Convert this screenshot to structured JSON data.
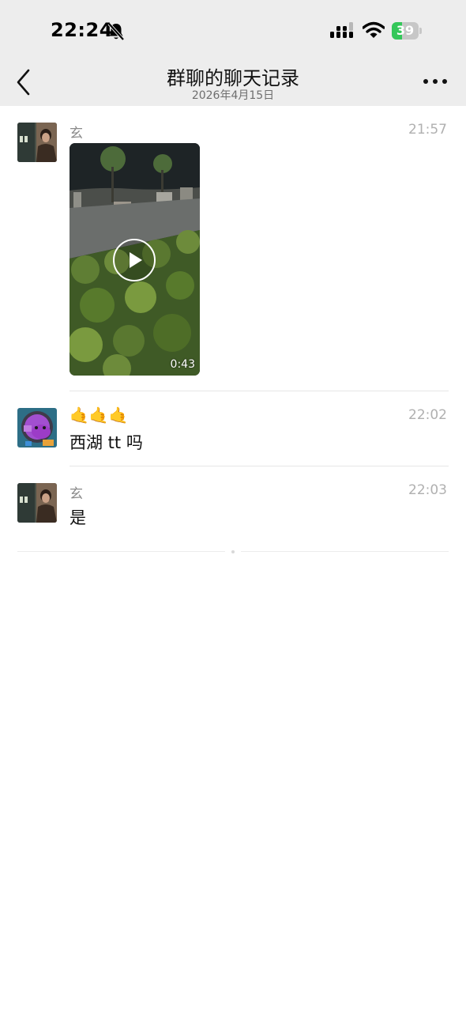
{
  "status_bar": {
    "time": "22:24",
    "silent_icon": "bell-slash-icon",
    "battery": "39",
    "battery_fraction": 0.39,
    "battery_color": "#34c759"
  },
  "header": {
    "title": "群聊的聊天记录",
    "date": "2026年4月15日",
    "back_icon": "chevron-left-icon",
    "more_icon": "ellipsis-icon"
  },
  "messages": [
    {
      "sender": "玄",
      "time": "21:57",
      "type": "video",
      "duration": "0:43",
      "avatar": "person-photo-avatar"
    },
    {
      "sender": "🤙🤙🤙",
      "time": "22:02",
      "type": "text",
      "text": "西湖 tt 吗",
      "avatar": "purple-cartoon-avatar"
    },
    {
      "sender": "玄",
      "time": "22:03",
      "type": "text",
      "text": "是",
      "avatar": "person-photo-avatar"
    }
  ],
  "colors": {
    "header_bg": "#ededed",
    "page_bg": "#ffffff"
  }
}
